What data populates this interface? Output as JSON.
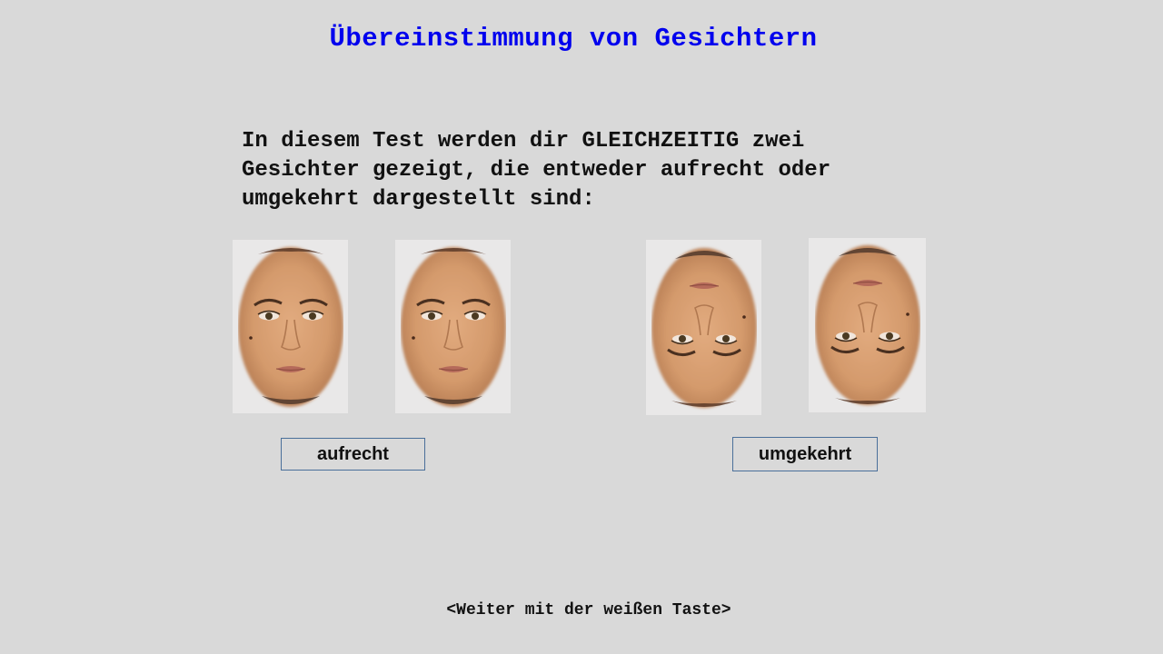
{
  "title": "Übereinstimmung von Gesichtern",
  "instructions": {
    "lines": [
      "In diesem Test werden dir GLEICHZEITIG zwei",
      "Gesichter gezeigt, die entweder aufrecht oder",
      "umgekehrt dargestellt sind:"
    ]
  },
  "faces": [
    {
      "orientation": "upright"
    },
    {
      "orientation": "upright"
    },
    {
      "orientation": "inverted"
    },
    {
      "orientation": "inverted"
    }
  ],
  "labels": {
    "upright": "aufrecht",
    "inverted": "umgekehrt"
  },
  "footer": "<Weiter mit der weißen Taste>",
  "colors": {
    "background": "#d9d9d9",
    "title": "#0000ee",
    "card": "#e9e8e8",
    "skin": "#d49a6c",
    "label_border": "#4a6f9a"
  }
}
